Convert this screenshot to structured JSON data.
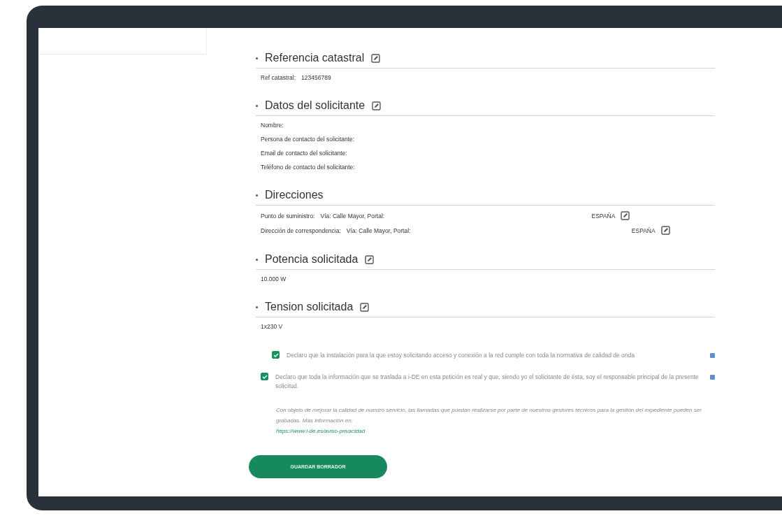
{
  "sections": [
    {
      "title": "Referencia catastral",
      "editable": true,
      "kind": "fields",
      "fields": [
        {
          "label": "Ref catastral:",
          "value": "123456789"
        }
      ]
    },
    {
      "title": "Datos del solicitante",
      "editable": true,
      "kind": "fields",
      "fields": [
        {
          "label": "Nombre:"
        },
        {
          "label": "Persona de contacto del solicitante:"
        },
        {
          "label": "Email de contacto del solicitante:"
        },
        {
          "label": "Teléfono de contacto del solicitante:"
        }
      ]
    },
    {
      "title": "Direcciones",
      "editable": false,
      "kind": "addresses",
      "rows": [
        {
          "label": "Punto de suministro:",
          "value": "Vía: Calle Mayor, Portal:",
          "country": "ESPAÑA"
        },
        {
          "label": "Dirección de correspondencia:",
          "value": "Vía: Calle Mayor, Portal:",
          "country": "ESPAÑA"
        }
      ]
    },
    {
      "title": "Potencia solicitada",
      "editable": true,
      "kind": "plain",
      "value": "10.000 W"
    },
    {
      "title": "Tension solicitada",
      "editable": true,
      "kind": "plain",
      "value": "1x230 V"
    }
  ],
  "consents": [
    {
      "text": "Declaro que la instalación para la que estoy solicitando acceso y conexión a la red cumple con toda la normativa de calidad de onda",
      "checked": true
    },
    {
      "text": "Declaro que toda la información que se traslada a i-DE en esta petición es real y que, siendo yo el solicitante de ésta, soy el responsable principal de la presente solicitud.",
      "checked": true
    }
  ],
  "note": {
    "text": "Con objeto de mejorar la calidad de nuestro servicio, las llamadas que puedan realizarse por parte de nuestros gestores técnicos para la gestión del expediente pueden ser grabadas. Más información en:",
    "link": "https://www.i-de.es/aviso-privacidad"
  },
  "save_button": "GUARDAR BORRADOR"
}
